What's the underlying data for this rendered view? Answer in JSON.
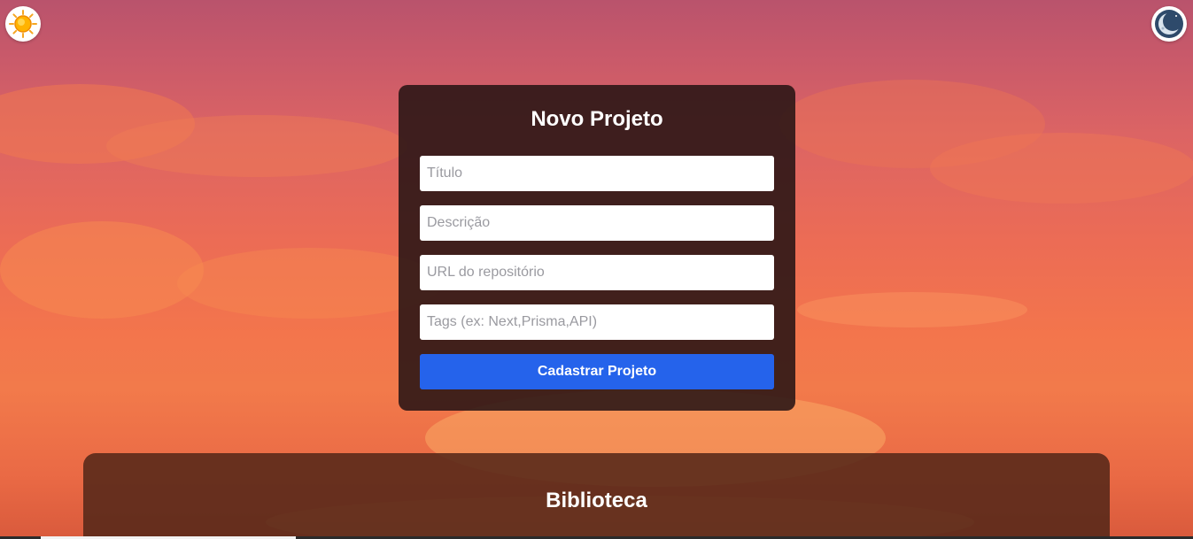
{
  "theme_toggle": {
    "light_icon": "sun-icon",
    "dark_icon": "moon-icon"
  },
  "form": {
    "title": "Novo Projeto",
    "fields": {
      "title_placeholder": "Título",
      "description_placeholder": "Descrição",
      "repo_placeholder": "URL do repositório",
      "tags_placeholder": "Tags (ex: Next,Prisma,API)"
    },
    "submit_label": "Cadastrar Projeto"
  },
  "library": {
    "title": "Biblioteca"
  },
  "colors": {
    "accent": "#2563eb",
    "card_background": "#281414",
    "library_background": "#552819"
  }
}
